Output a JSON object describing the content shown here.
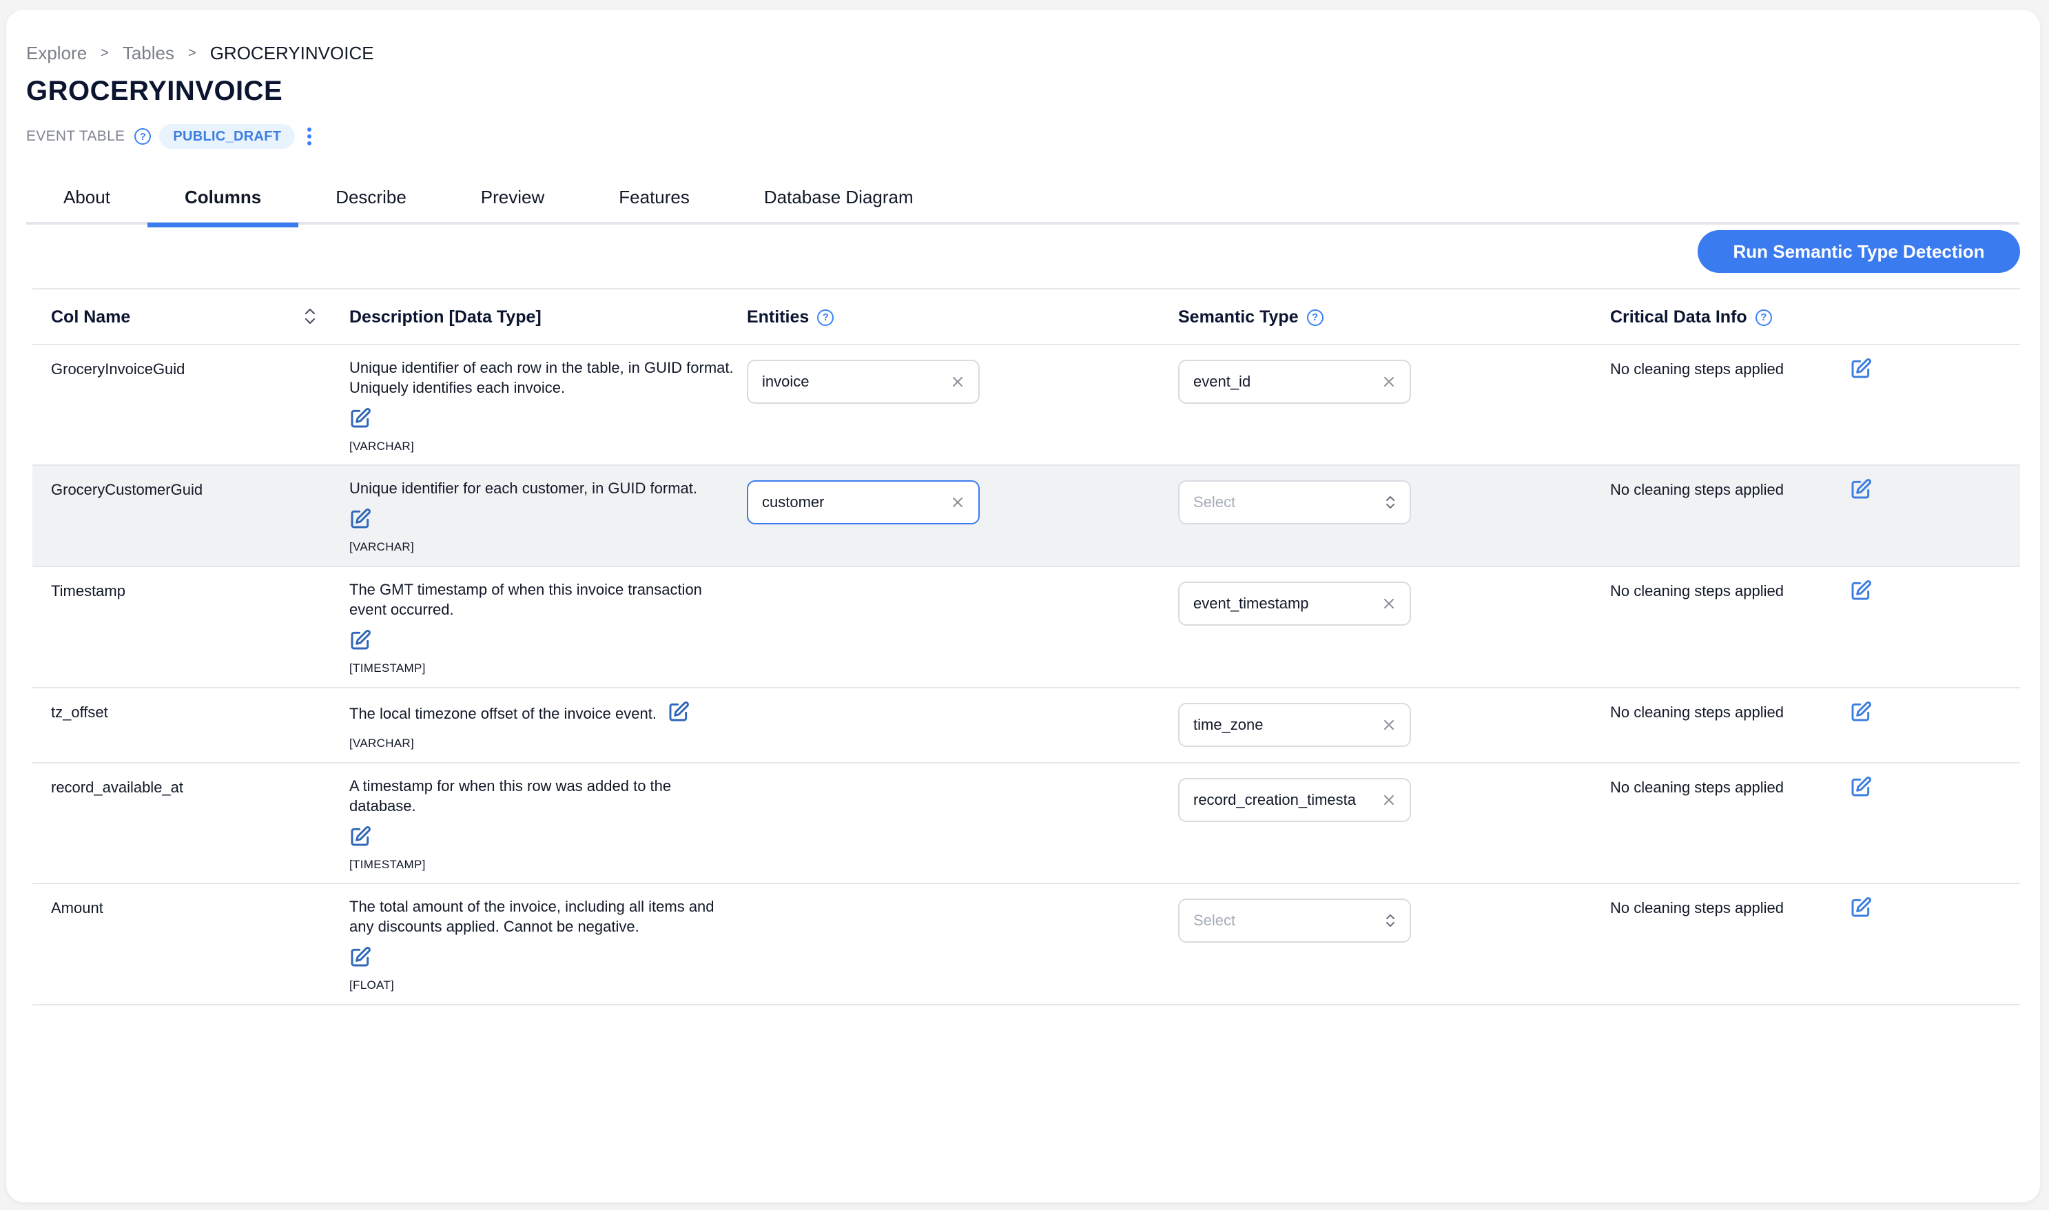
{
  "breadcrumb": [
    {
      "label": "Explore"
    },
    {
      "label": "Tables"
    },
    {
      "label": "GROCERYINVOICE"
    }
  ],
  "breadcrumb_separator": ">",
  "page_title": "GROCERYINVOICE",
  "table_type": "EVENT TABLE",
  "status_badge": "PUBLIC_DRAFT",
  "tabs": [
    {
      "label": "About",
      "active": false
    },
    {
      "label": "Columns",
      "active": true
    },
    {
      "label": "Describe",
      "active": false
    },
    {
      "label": "Preview",
      "active": false
    },
    {
      "label": "Features",
      "active": false
    },
    {
      "label": "Database Diagram",
      "active": false
    }
  ],
  "run_button_label": "Run Semantic Type Detection",
  "table": {
    "headers": {
      "col_name": "Col Name",
      "description": "Description [Data Type]",
      "entities": "Entities",
      "semantic_type": "Semantic Type",
      "critical_data_info": "Critical Data Info"
    },
    "semantic_placeholder": "Select",
    "rows": [
      {
        "col_name": "GroceryInvoiceGuid",
        "description": "Unique identifier of each row in the table, in GUID format. Uniquely identifies each invoice.",
        "data_type": "[VARCHAR]",
        "entity": "invoice",
        "semantic_type": "event_id",
        "critical_data_info": "No cleaning steps applied"
      },
      {
        "col_name": "GroceryCustomerGuid",
        "description": "Unique identifier for each customer, in GUID format.",
        "data_type": "[VARCHAR]",
        "entity": "customer",
        "semantic_type": null,
        "critical_data_info": "No cleaning steps applied",
        "highlighted": true
      },
      {
        "col_name": "Timestamp",
        "description": "The GMT timestamp of when this invoice transaction event occurred.",
        "data_type": "[TIMESTAMP]",
        "entity": null,
        "semantic_type": "event_timestamp",
        "critical_data_info": "No cleaning steps applied"
      },
      {
        "col_name": "tz_offset",
        "description": "The local timezone offset of the invoice event.",
        "data_type": "[VARCHAR]",
        "entity": null,
        "semantic_type": "time_zone",
        "critical_data_info": "No cleaning steps applied"
      },
      {
        "col_name": "record_available_at",
        "description": "A timestamp for when this row was added to the database.",
        "data_type": "[TIMESTAMP]",
        "entity": null,
        "semantic_type": "record_creation_timesta",
        "critical_data_info": "No cleaning steps applied"
      },
      {
        "col_name": "Amount",
        "description": "The total amount of the invoice, including all items and any discounts applied. Cannot be negative.",
        "data_type": "[FLOAT]",
        "entity": null,
        "semantic_type": null,
        "critical_data_info": "No cleaning steps applied"
      }
    ]
  },
  "colors": {
    "accent": "#3b7bf0",
    "badge_bg": "#e8f3fd",
    "row_highlight": "#f1f2f4",
    "edit_icon": "#3b7de0",
    "edit_icon_desc": "#2f66b8"
  }
}
